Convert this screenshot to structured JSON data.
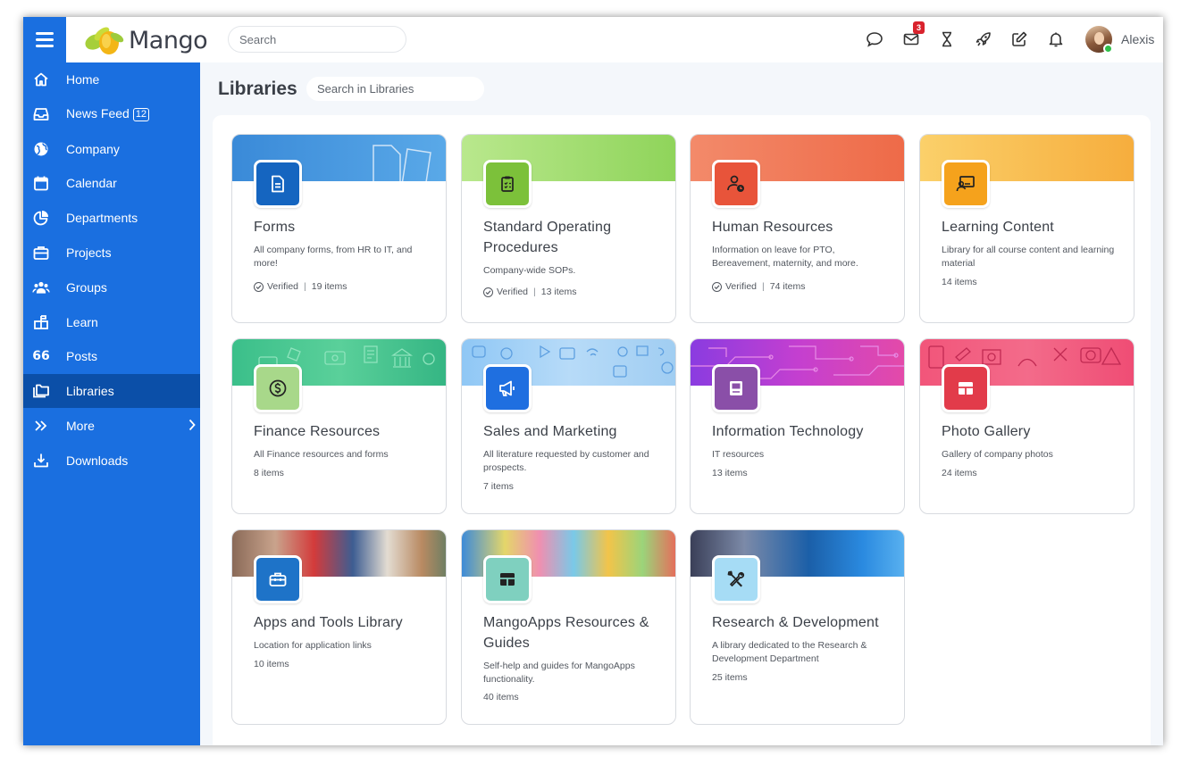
{
  "header": {
    "logo_text": "Mango",
    "search_placeholder": "Search",
    "mail_badge": "3",
    "user_name": "Alexis"
  },
  "sidebar": {
    "items": [
      {
        "label": "Home",
        "icon": "home-icon"
      },
      {
        "label": "News Feed",
        "icon": "inbox-icon",
        "badge": "12"
      },
      {
        "label": "Company",
        "icon": "globe-icon"
      },
      {
        "label": "Calendar",
        "icon": "calendar-icon"
      },
      {
        "label": "Departments",
        "icon": "pie-chart-icon"
      },
      {
        "label": "Projects",
        "icon": "briefcase-icon"
      },
      {
        "label": "Groups",
        "icon": "users-icon"
      },
      {
        "label": "Learn",
        "icon": "learn-icon"
      },
      {
        "label": "Posts",
        "icon": "quote-icon",
        "icon_text": "66"
      },
      {
        "label": "Libraries",
        "icon": "folders-icon",
        "active": true
      },
      {
        "label": "More",
        "icon": "double-chevron-icon"
      },
      {
        "label": "Downloads",
        "icon": "download-icon"
      }
    ]
  },
  "main": {
    "title": "Libraries",
    "search_placeholder": "Search in Libraries",
    "libraries": [
      {
        "title": "Forms",
        "description": "All company forms, from HR to IT, and more!",
        "verified": "Verified",
        "items": "19 items",
        "icon": "document-icon",
        "icon_color": "#1565c0"
      },
      {
        "title": "Standard Operating Procedures",
        "description": "Company-wide SOPs.",
        "verified": "Verified",
        "items": "13 items",
        "icon": "clipboard-icon",
        "icon_color": "#7cc13a"
      },
      {
        "title": "Human Resources",
        "description": "Information on leave for PTO, Bereavement, maternity, and more.",
        "verified": "Verified",
        "items": "74 items",
        "icon": "user-clock-icon",
        "icon_color": "#e8543a"
      },
      {
        "title": "Learning Content",
        "description": "Library for all course content and learning material",
        "items": "14 items",
        "icon": "presentation-icon",
        "icon_color": "#f5a21c"
      },
      {
        "title": "Finance Resources",
        "description": "All Finance resources and forms",
        "items": "8 items",
        "icon": "dollar-icon",
        "icon_color": "#a8d88a"
      },
      {
        "title": "Sales and Marketing",
        "description": "All literature requested by customer and prospects.",
        "items": "7 items",
        "icon": "megaphone-icon",
        "icon_color": "#1f6fe0"
      },
      {
        "title": "Information Technology",
        "description": "IT resources",
        "items": "13 items",
        "icon": "computer-icon",
        "icon_color": "#8a4fa8"
      },
      {
        "title": "Photo Gallery",
        "description": "Gallery of company photos",
        "items": "24 items",
        "icon": "gallery-icon",
        "icon_color": "#e23b4a"
      },
      {
        "title": "Apps and Tools Library",
        "description": "Location for application links",
        "items": "10 items",
        "icon": "toolbox-icon",
        "icon_color": "#1e73c8"
      },
      {
        "title": "MangoApps Resources & Guides",
        "description": "Self-help and guides for MangoApps functionality.",
        "items": "40 items",
        "icon": "grid-icon",
        "icon_color": "#7fd0bf"
      },
      {
        "title": "Research & Development",
        "description": "A library dedicated to the Research & Development Department",
        "items": "25 items",
        "icon": "tools-icon",
        "icon_color": "#a6dcf5"
      }
    ]
  }
}
